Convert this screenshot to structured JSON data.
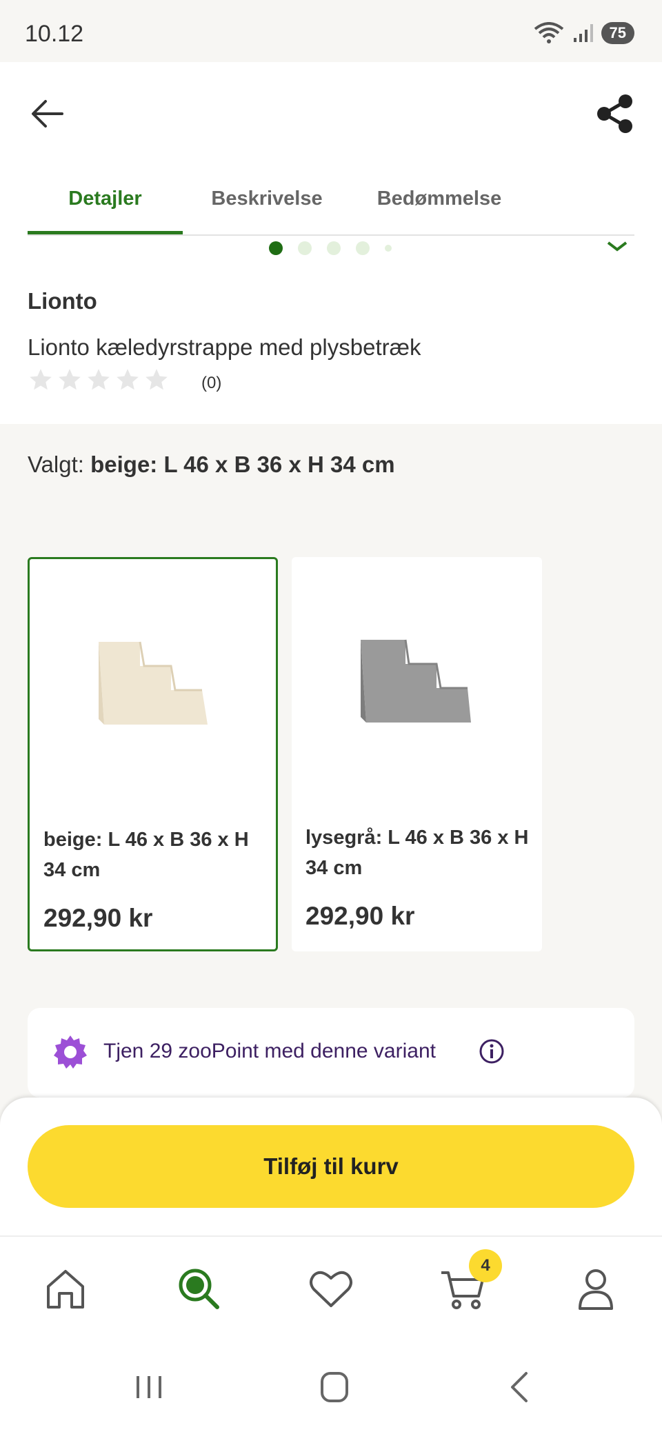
{
  "status": {
    "time": "10.12",
    "battery": "75"
  },
  "tabs": [
    {
      "label": "Detajler"
    },
    {
      "label": "Beskrivelse"
    },
    {
      "label": "Bedømmelse"
    }
  ],
  "product": {
    "brand": "Lionto",
    "title": "Lionto kæledyrstrappe med plysbetræk",
    "rating_value": 0,
    "rating_count": "(0)",
    "image_count": 5,
    "active_image": 1
  },
  "selection": {
    "prefix": "Valgt:",
    "value": "beige: L 46 x B 36 x H 34 cm"
  },
  "variants": [
    {
      "label": "beige: L 46 x B 36 x H 34 cm",
      "price": "292,90 kr",
      "color": "beige"
    },
    {
      "label": "lysegrå: L 46 x B 36 x H 34 cm",
      "price": "292,90 kr",
      "color": "lysegrå"
    }
  ],
  "points": {
    "text": "Tjen 29 zooPoint med denne variant"
  },
  "cta": {
    "label": "Tilføj til kurv"
  },
  "nav": {
    "cart_badge": "4",
    "items": [
      "home-icon",
      "search-icon",
      "heart-icon",
      "cart-icon",
      "profile-icon"
    ]
  },
  "colors": {
    "accent_green": "#2a7a1f",
    "cta_yellow": "#fcda2f",
    "points_purple": "#9c4fd6"
  }
}
